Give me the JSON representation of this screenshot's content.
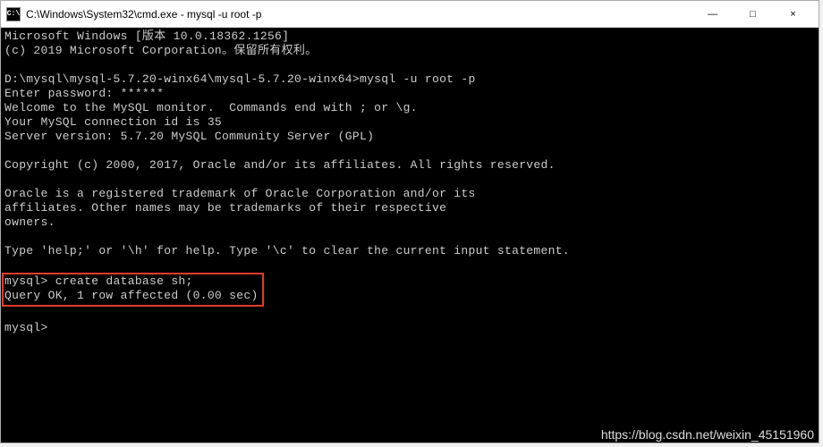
{
  "titlebar": {
    "icon_label": "C:\\",
    "title": "C:\\Windows\\System32\\cmd.exe - mysql  -u root -p",
    "minimize": "—",
    "maximize": "□",
    "close": "×"
  },
  "terminal": {
    "line1": "Microsoft Windows [版本 10.0.18362.1256]",
    "line2": "(c) 2019 Microsoft Corporation。保留所有权利。",
    "line3": "",
    "line4": "D:\\mysql\\mysql-5.7.20-winx64\\mysql-5.7.20-winx64>mysql -u root -p",
    "line5": "Enter password: ******",
    "line6": "Welcome to the MySQL monitor.  Commands end with ; or \\g.",
    "line7": "Your MySQL connection id is 35",
    "line8": "Server version: 5.7.20 MySQL Community Server (GPL)",
    "line9": "",
    "line10": "Copyright (c) 2000, 2017, Oracle and/or its affiliates. All rights reserved.",
    "line11": "",
    "line12": "Oracle is a registered trademark of Oracle Corporation and/or its",
    "line13": "affiliates. Other names may be trademarks of their respective",
    "line14": "owners.",
    "line15": "",
    "line16": "Type 'help;' or '\\h' for help. Type '\\c' to clear the current input statement.",
    "line17": "",
    "highlight_line1": "mysql> create database sh;",
    "highlight_line2": "Query OK, 1 row affected (0.00 sec)",
    "line18": "",
    "line19": "mysql>"
  },
  "watermark": "https://blog.csdn.net/weixin_45151960"
}
